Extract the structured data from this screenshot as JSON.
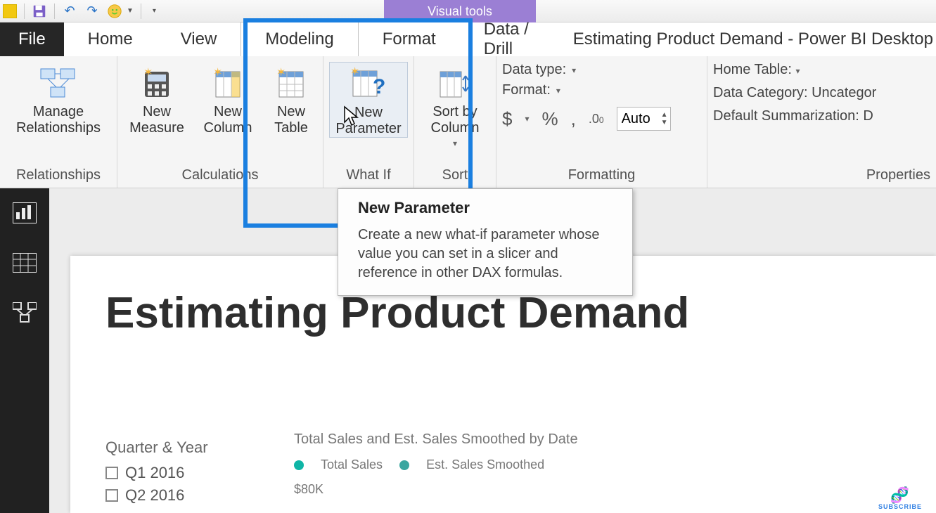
{
  "app_title": "Estimating Product Demand - Power BI Desktop",
  "context_tab_title": "Visual tools",
  "tabs": {
    "file": "File",
    "home": "Home",
    "view": "View",
    "modeling": "Modeling",
    "format": "Format",
    "datadrill": "Data / Drill"
  },
  "ribbon": {
    "relationships": {
      "manage": "Manage\nRelationships",
      "group_label": "Relationships"
    },
    "calculations": {
      "new_measure": "New\nMeasure",
      "new_column": "New\nColumn",
      "new_table": "New\nTable",
      "group_label": "Calculations"
    },
    "whatif": {
      "new_parameter": "New\nParameter",
      "group_label": "What If"
    },
    "sort": {
      "sort_by_column": "Sort by\nColumn",
      "group_label": "Sort"
    },
    "formatting": {
      "data_type": "Data type:",
      "format": "Format:",
      "dollar": "$",
      "percent": "%",
      "comma": ",",
      "decimal_icon": ".00",
      "auto": "Auto",
      "group_label": "Formatting"
    },
    "properties": {
      "home_table": "Home Table:",
      "data_category": "Data Category: Uncategor",
      "default_summarization": "Default Summarization: D",
      "group_label": "Properties"
    }
  },
  "tooltip": {
    "title": "New Parameter",
    "body": "Create a new what-if parameter whose value you can set in a slicer and reference in other DAX formulas."
  },
  "page_heading": "Estimating Product Demand",
  "slicer": {
    "title": "Quarter & Year",
    "options": [
      "Q1 2016",
      "Q2 2016"
    ]
  },
  "chart": {
    "title": "Total Sales and Est. Sales Smoothed by Date",
    "legend": [
      "Total Sales",
      "Est. Sales Smoothed"
    ],
    "y_tick": "$80K"
  },
  "subscribe_label": "SUBSCRIBE"
}
